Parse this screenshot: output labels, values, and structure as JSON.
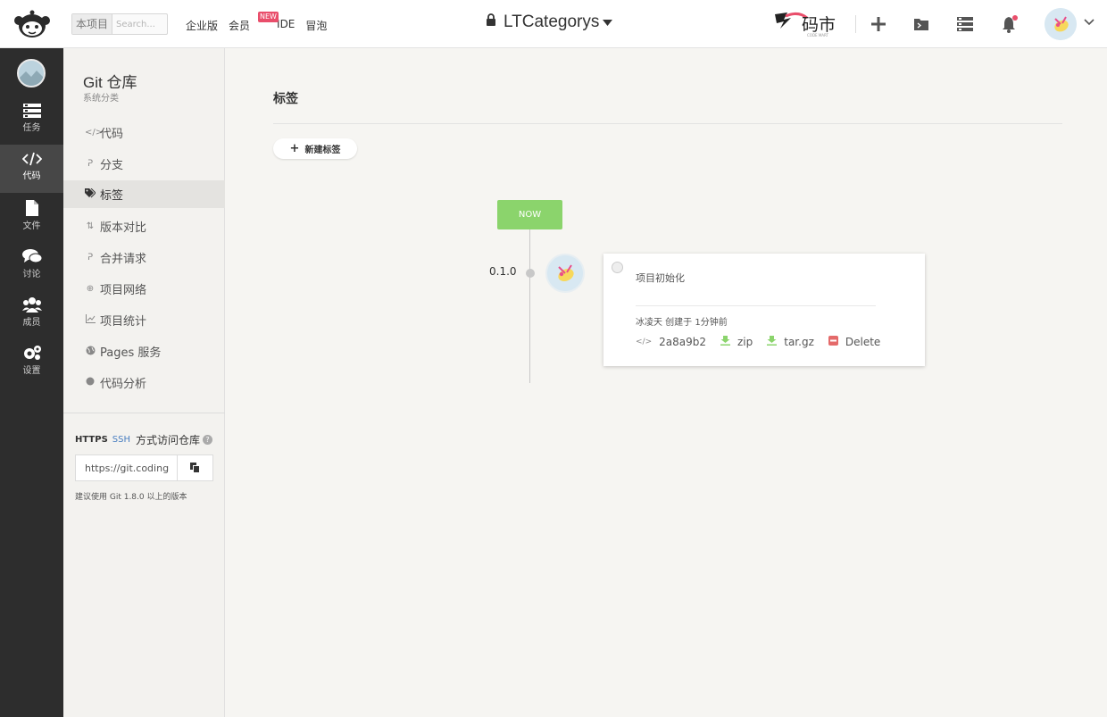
{
  "topbar": {
    "search_scope": "本项目",
    "search_placeholder": "Search...",
    "nav": [
      "企业版",
      "会员",
      "IDE",
      "冒泡"
    ],
    "new_badge": "NEW",
    "project_name": "LTCategorys",
    "mart_logo_text": "码市",
    "mart_logo_sub": "CODE MART"
  },
  "dark_sidebar": {
    "items": [
      {
        "label": "任务",
        "icon": "tasks-icon"
      },
      {
        "label": "代码",
        "icon": "code-icon"
      },
      {
        "label": "文件",
        "icon": "file-icon"
      },
      {
        "label": "讨论",
        "icon": "discussion-icon"
      },
      {
        "label": "成员",
        "icon": "members-icon"
      },
      {
        "label": "设置",
        "icon": "settings-icon"
      }
    ],
    "active": "代码"
  },
  "repo_sidebar": {
    "title": "Git 仓库",
    "subtitle": "系统分类",
    "menu": [
      {
        "label": "代码",
        "icon": "</>"
      },
      {
        "label": "分支",
        "icon": "branch"
      },
      {
        "label": "标签",
        "icon": "tag"
      },
      {
        "label": "版本对比",
        "icon": "compare"
      },
      {
        "label": "合并请求",
        "icon": "merge"
      },
      {
        "label": "项目网络",
        "icon": "network"
      },
      {
        "label": "项目统计",
        "icon": "stats"
      },
      {
        "label": "Pages 服务",
        "icon": "globe"
      },
      {
        "label": "代码分析",
        "icon": "analysis"
      }
    ],
    "active": "标签",
    "access": {
      "https": "HTTPS",
      "ssh": "SSH",
      "label": "方式访问仓库",
      "url": "https://git.coding",
      "note": "建议使用 Git 1.8.0 以上的版本"
    }
  },
  "main": {
    "title": "标签",
    "new_tag_button": "新建标签",
    "now_label": "NOW",
    "tags": [
      {
        "version": "0.1.0",
        "message": "项目初始化",
        "meta": "冰凌天 创建于 1分钟前",
        "commit": "2a8a9b2",
        "zip": "zip",
        "targz": "tar.gz",
        "delete": "Delete"
      }
    ]
  },
  "colors": {
    "accent_green": "#8bd46c",
    "delete_red": "#e46a6a",
    "sidebar_dark": "#2d2d2d",
    "badge_pink": "#e94e6b"
  }
}
